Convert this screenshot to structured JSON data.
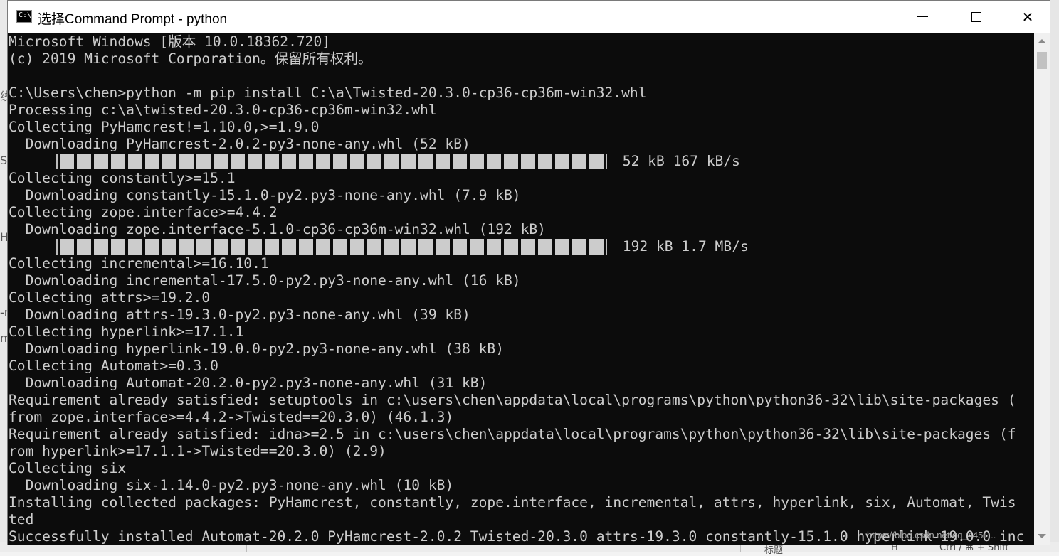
{
  "window": {
    "title": "选择Command Prompt - python",
    "icon": "cmd-console-icon",
    "icon_text": "C:\\",
    "controls": [
      "minimize-icon",
      "maximize-icon",
      "close-icon"
    ],
    "close_glyph": "✕"
  },
  "console": {
    "lines": [
      "Microsoft Windows [版本 10.0.18362.720]",
      "(c) 2019 Microsoft Corporation。保留所有权利。",
      "",
      "C:\\Users\\chen>python -m pip install C:\\a\\Twisted-20.3.0-cp36-cp36m-win32.whl",
      "Processing c:\\a\\twisted-20.3.0-cp36-cp36m-win32.whl",
      "Collecting PyHamcrest!=1.10.0,>=1.9.0",
      "  Downloading PyHamcrest-2.0.2-py3-none-any.whl (52 kB)",
      "",
      "Collecting constantly>=15.1",
      "  Downloading constantly-15.1.0-py2.py3-none-any.whl (7.9 kB)",
      "Collecting zope.interface>=4.4.2",
      "  Downloading zope.interface-5.1.0-cp36-cp36m-win32.whl (192 kB)",
      "",
      "Collecting incremental>=16.10.1",
      "  Downloading incremental-17.5.0-py2.py3-none-any.whl (16 kB)",
      "Collecting attrs>=19.2.0",
      "  Downloading attrs-19.3.0-py2.py3-none-any.whl (39 kB)",
      "Collecting hyperlink>=17.1.1",
      "  Downloading hyperlink-19.0.0-py2.py3-none-any.whl (38 kB)",
      "Collecting Automat>=0.3.0",
      "  Downloading Automat-20.2.0-py2.py3-none-any.whl (31 kB)",
      "Requirement already satisfied: setuptools in c:\\users\\chen\\appdata\\local\\programs\\python\\python36-32\\lib\\site-packages (",
      "from zope.interface>=4.4.2->Twisted==20.3.0) (46.1.3)",
      "Requirement already satisfied: idna>=2.5 in c:\\users\\chen\\appdata\\local\\programs\\python\\python36-32\\lib\\site-packages (f",
      "rom hyperlink>=17.1.1->Twisted==20.3.0) (2.9)",
      "Collecting six",
      "  Downloading six-1.14.0-py2.py3-none-any.whl (10 kB)",
      "Installing collected packages: PyHamcrest, constantly, zope.interface, incremental, attrs, hyperlink, six, Automat, Twis",
      "ted",
      "Successfully installed Automat-20.2.0 PyHamcrest-2.0.2 Twisted-20.3.0 attrs-19.3.0 constantly-15.1.0 hyperlink-19.0.0 inc"
    ],
    "progress_bars": [
      {
        "fraction": 1.0,
        "text": " 52 kB 167 kB/s"
      },
      {
        "fraction": 1.0,
        "text": " 192 kB 1.7 MB/s"
      }
    ],
    "colors": {
      "background": "#0c0c0c",
      "foreground": "#cccccc"
    }
  },
  "background": {
    "left_chars": [
      "线",
      "S",
      "H",
      "-r",
      "m"
    ],
    "bottom_fragments": [
      "标题",
      "H",
      "Ctrl / ⌘ + Shift"
    ],
    "watermark": "https://blog.csdn.net/qq_4451..."
  }
}
